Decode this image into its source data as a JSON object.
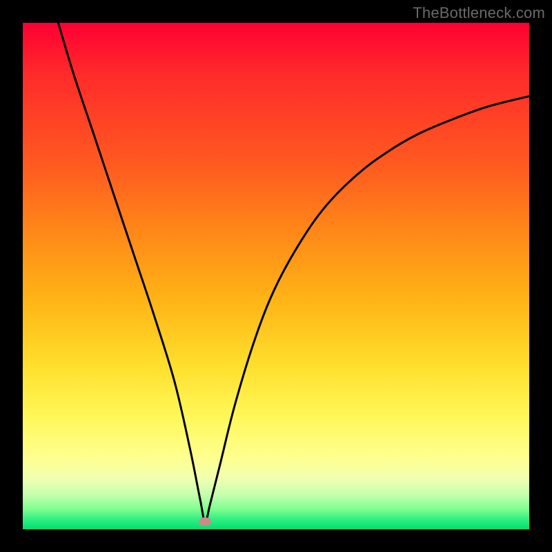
{
  "watermark": "TheBottleneck.com",
  "colors": {
    "frame": "#000000",
    "gradient_top": "#ff0033",
    "gradient_bottom": "#00e070",
    "curve": "#000000",
    "marker": "#cb8b88"
  },
  "chart_data": {
    "type": "line",
    "title": "",
    "xlabel": "",
    "ylabel": "",
    "xlim": [
      0,
      100
    ],
    "ylim": [
      0,
      100
    ],
    "notes": "V-shaped curve with one sharp minimum; background gradient indicates quality (red=bad at top, green=good at bottom). Pink marker at the trough.",
    "marker": {
      "x": 36,
      "y": 1.5
    },
    "series": [
      {
        "name": "curve",
        "x": [
          7,
          10,
          14,
          18,
          22,
          26,
          30,
          33,
          35,
          36,
          37,
          39,
          42,
          46,
          50,
          55,
          60,
          66,
          72,
          78,
          85,
          92,
          100
        ],
        "y": [
          100,
          90,
          78,
          66,
          54,
          42,
          29,
          16,
          6,
          1.5,
          5,
          13,
          25,
          38,
          48,
          57,
          64,
          70,
          74.5,
          78,
          81,
          83.5,
          85.5
        ]
      }
    ]
  }
}
